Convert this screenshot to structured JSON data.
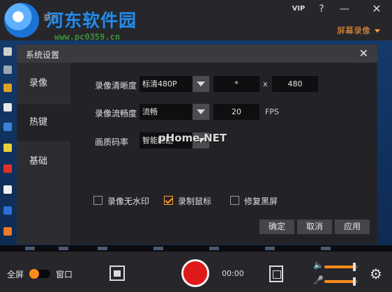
{
  "titlebar": {
    "app_tag": "录屏",
    "watermark_title": "河东软件园",
    "watermark_url": "www.pc0359.cn",
    "vip_label": "VIP",
    "help_label": "?",
    "minimize_label": "—",
    "close_label": "✕",
    "mode_dropdown": "屏幕录像"
  },
  "dialog": {
    "title": "系统设置",
    "close_label": "✕",
    "nav": [
      {
        "label": "录像"
      },
      {
        "label": "热键"
      },
      {
        "label": "基础"
      }
    ],
    "clarity": {
      "label": "录像清晰度",
      "selected": "标清480P",
      "width": "*",
      "x_sep": "x",
      "height": "480"
    },
    "fluency": {
      "label": "录像流畅度",
      "selected": "流畅",
      "fps": "20",
      "unit": "FPS"
    },
    "bitrate": {
      "label": "画质码率",
      "selected": "智能匹配",
      "overlay_watermark": "pHome.NET"
    },
    "checkboxes": [
      {
        "label": "录像无水印",
        "checked": false
      },
      {
        "label": "录制鼠标",
        "checked": true
      },
      {
        "label": "修复黑屏",
        "checked": false
      }
    ],
    "buttons": {
      "ok": "确定",
      "cancel": "取消",
      "apply": "应用"
    }
  },
  "controls": {
    "fullscreen_label": "全屏",
    "window_label": "窗口",
    "timer": "00:00",
    "volume_level": 0.9,
    "mic_level": 0.9
  },
  "colors": {
    "accent": "#ff9a2f",
    "record": "#e01a1a"
  }
}
